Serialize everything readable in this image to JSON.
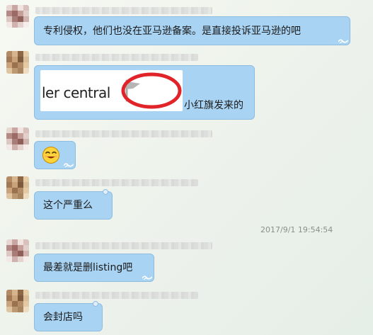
{
  "messages": {
    "m1": {
      "text": "专利侵权，他们也没在亚马逊备案。是直接投诉亚马逊的吧"
    },
    "m2": {
      "image_text": "ler central",
      "caption": "小红旗发来的"
    },
    "m3": {
      "emoji": "smiling-face-emoji"
    },
    "m4": {
      "text": "这个严重么"
    },
    "m5": {
      "text": "最差就是删listing吧"
    },
    "m6": {
      "text": "会封店吗"
    }
  },
  "timestamp": "2017/9/1 19:54:54",
  "colors": {
    "bubble": "#a8d3f3",
    "bubble_border": "#8fbde0",
    "annotation": "#e0242a"
  }
}
